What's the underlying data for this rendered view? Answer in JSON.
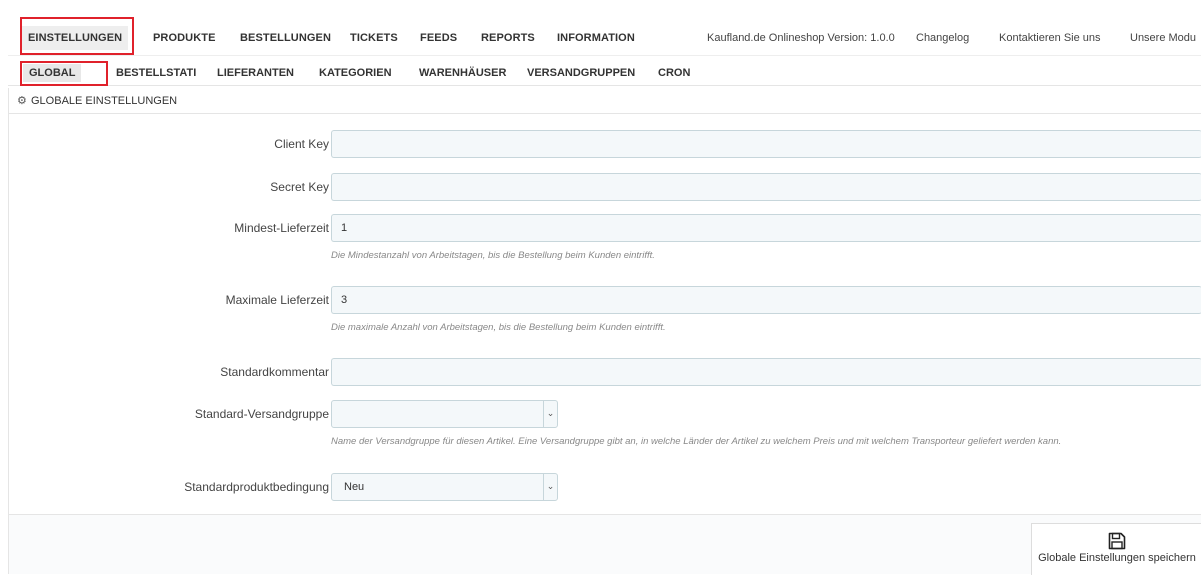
{
  "top_nav": {
    "tabs": [
      {
        "label": "EINSTELLUNGEN"
      },
      {
        "label": "PRODUKTE"
      },
      {
        "label": "BESTELLUNGEN"
      },
      {
        "label": "TICKETS"
      },
      {
        "label": "FEEDS"
      },
      {
        "label": "REPORTS"
      },
      {
        "label": "INFORMATION"
      }
    ],
    "version": "Kaufland.de Onlineshop Version: 1.0.0",
    "changelog": "Changelog",
    "contact": "Kontaktieren Sie uns",
    "modules": "Unsere Modu"
  },
  "sub_nav": {
    "tabs": [
      {
        "label": "GLOBAL"
      },
      {
        "label": "BESTELLSTATI"
      },
      {
        "label": "LIEFERANTEN"
      },
      {
        "label": "KATEGORIEN"
      },
      {
        "label": "WARENHÄUSER"
      },
      {
        "label": "VERSANDGRUPPEN"
      },
      {
        "label": "CRON"
      }
    ]
  },
  "panel": {
    "icon": "gears-icon",
    "title": "GLOBALE EINSTELLUNGEN"
  },
  "form": {
    "client_key": {
      "label": "Client Key",
      "value": ""
    },
    "secret_key": {
      "label": "Secret Key",
      "value": ""
    },
    "min_delivery": {
      "label": "Mindest-Lieferzeit",
      "value": "1",
      "help": "Die Mindestanzahl von Arbeitstagen, bis die Bestellung beim Kunden eintrifft."
    },
    "max_delivery": {
      "label": "Maximale Lieferzeit",
      "value": "3",
      "help": "Die maximale Anzahl von Arbeitstagen, bis die Bestellung beim Kunden eintrifft."
    },
    "default_comment": {
      "label": "Standardkommentar",
      "value": ""
    },
    "default_shipping_group": {
      "label": "Standard-Versandgruppe",
      "value": "",
      "help": "Name der Versandgruppe für diesen Artikel. Eine Versandgruppe gibt an, in welche Länder der Artikel zu welchem Preis und mit welchem Transporteur geliefert werden kann."
    },
    "default_condition": {
      "label": "Standardproduktbedingung",
      "value": "Neu"
    }
  },
  "footer": {
    "save_label": "Globale Einstellungen speichern",
    "save_icon": "floppy-disk-icon"
  },
  "colors": {
    "highlight": "#e0212b",
    "input_bg": "#f4f8fa",
    "input_border": "#c7d6db"
  }
}
